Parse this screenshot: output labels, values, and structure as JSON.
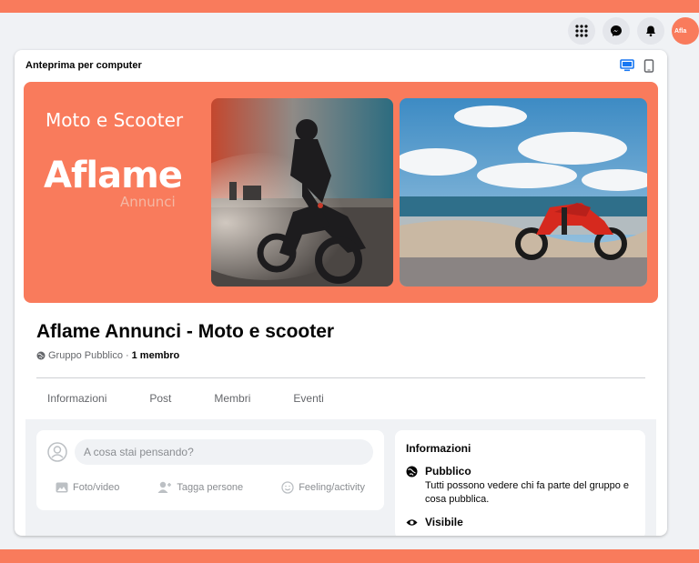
{
  "topbar": {
    "avatar_text": "Afla",
    "icons": [
      "menu-grid-icon",
      "messenger-icon",
      "bell-icon"
    ]
  },
  "preview": {
    "heading": "Anteprima per computer",
    "device_icons": [
      "desktop-icon",
      "mobile-icon"
    ]
  },
  "cover": {
    "title": "Moto e Scooter",
    "logo": "Aflame",
    "logo_sub": "Annunci"
  },
  "group": {
    "name": "Aflame Annunci - Moto e scooter",
    "privacy": "Gruppo Pubblico",
    "separator": "·",
    "members": "1 membro"
  },
  "tabs": [
    "Informazioni",
    "Post",
    "Membri",
    "Eventi"
  ],
  "composer": {
    "placeholder": "A cosa stai pensando?",
    "actions": [
      "Foto/video",
      "Tagga persone",
      "Feeling/activity"
    ]
  },
  "info": {
    "title": "Informazioni",
    "public_title": "Pubblico",
    "public_desc": "Tutti possono vedere chi fa parte del gruppo e cosa pubblica.",
    "visible_title": "Visibile"
  },
  "colors": {
    "accent": "#f97b5c",
    "desktop_icon": "#1877f2"
  }
}
